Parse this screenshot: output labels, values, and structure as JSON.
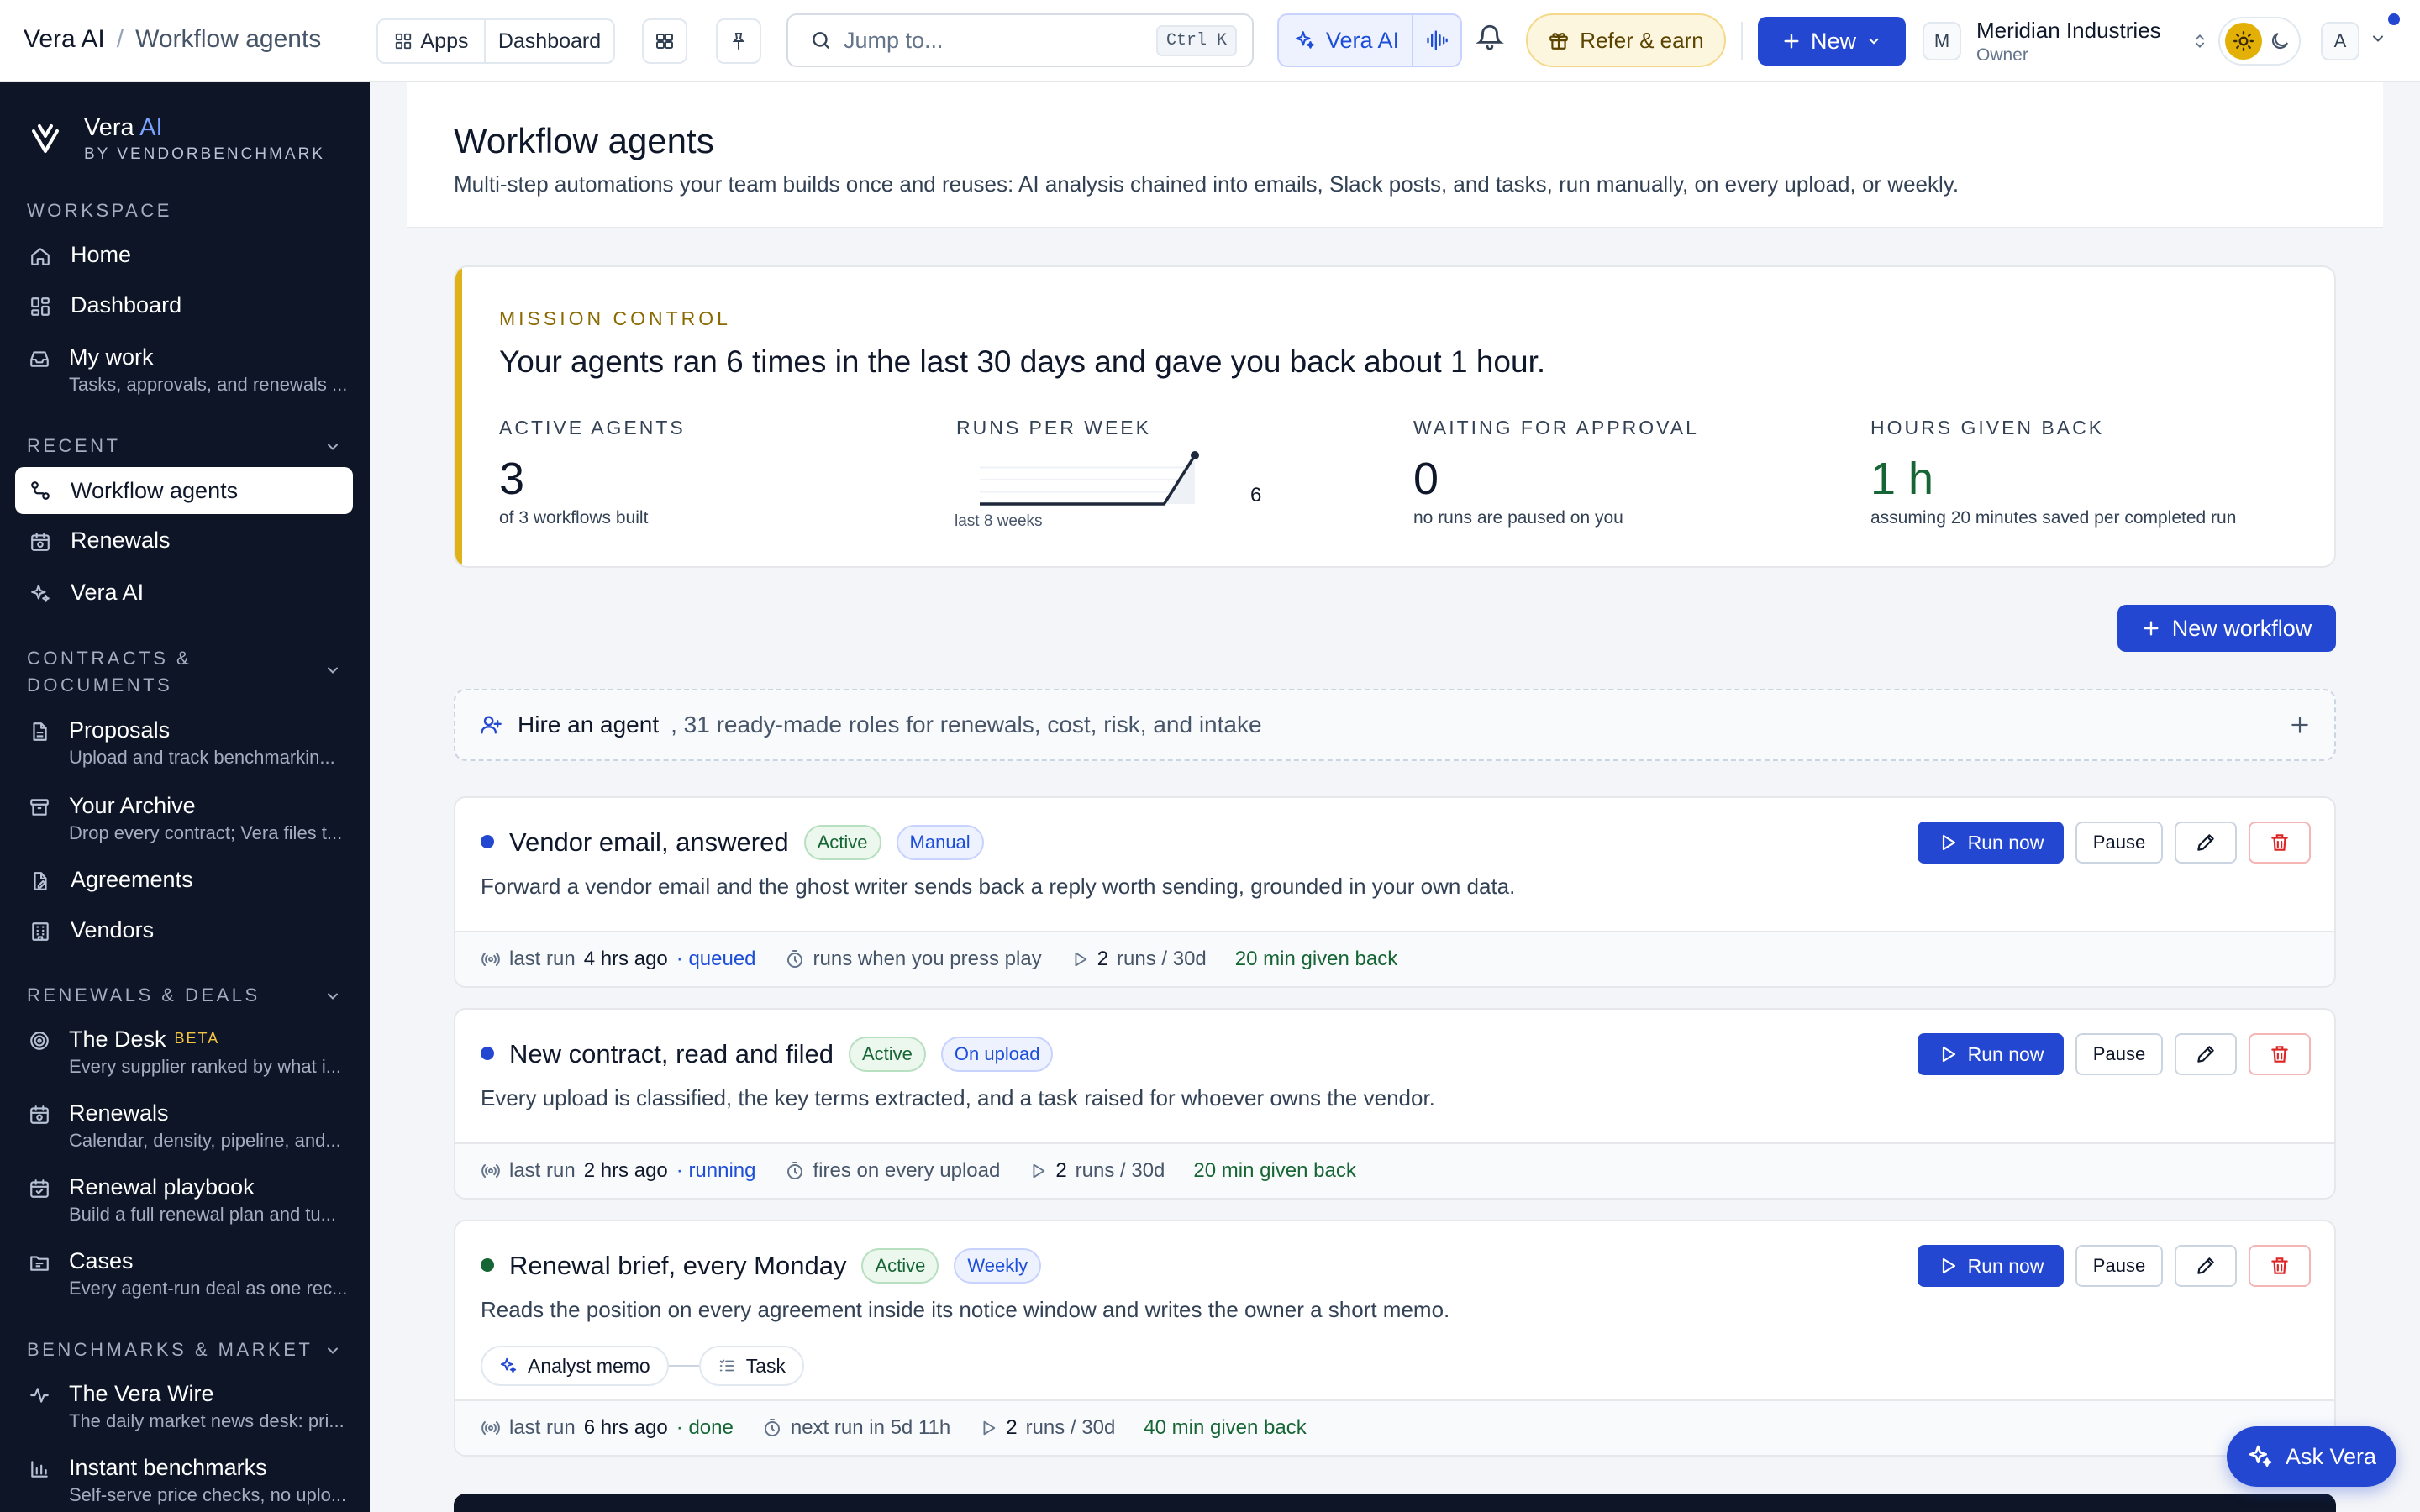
{
  "topbar": {
    "breadcrumb_root": "Vera AI",
    "breadcrumb_sep": "/",
    "breadcrumb_current": "Workflow agents",
    "apps_label": "Apps",
    "dashboard_label": "Dashboard",
    "search_placeholder": "Jump to...",
    "search_shortcut": "Ctrl K",
    "vera_label": "Vera AI",
    "refer_label": "Refer & earn",
    "new_label": "New",
    "org_initial": "M",
    "org_name": "Meridian Industries",
    "org_role": "Owner",
    "user_initial": "A"
  },
  "sidebar": {
    "brand_name": "Vera",
    "brand_ai": "AI",
    "brand_by": "BY VENDORBENCHMARK",
    "workspace_label": "WORKSPACE",
    "home": "Home",
    "dashboard": "Dashboard",
    "mywork": "My work",
    "mywork_sub": "Tasks, approvals, and renewals ...",
    "recent_label": "RECENT",
    "recent_workflow": "Workflow agents",
    "recent_renewals": "Renewals",
    "recent_vera": "Vera AI",
    "contracts_label_1": "CONTRACTS &",
    "contracts_label_2": "DOCUMENTS",
    "proposals": "Proposals",
    "proposals_sub": "Upload and track benchmarkin...",
    "archive": "Your Archive",
    "archive_sub": "Drop every contract; Vera files t...",
    "agreements": "Agreements",
    "vendors": "Vendors",
    "renewals_label": "RENEWALS & DEALS",
    "desk": "The Desk",
    "desk_badge": "BETA",
    "desk_sub": "Every supplier ranked by what i...",
    "renewals": "Renewals",
    "renewals_sub": "Calendar, density, pipeline, and...",
    "playbook": "Renewal playbook",
    "playbook_sub": "Build a full renewal plan and tu...",
    "cases": "Cases",
    "cases_sub": "Every agent-run deal as one rec...",
    "bench_label": "BENCHMARKS & MARKET",
    "wire": "The Vera Wire",
    "wire_sub": "The daily market news desk: pri...",
    "instant": "Instant benchmarks",
    "instant_sub": "Self-serve price checks, no uplo..."
  },
  "page": {
    "title": "Workflow agents",
    "subtitle": "Multi-step automations your team builds once and reuses: AI analysis chained into emails, Slack posts, and tasks, run manually, on every upload, or weekly."
  },
  "mission": {
    "kicker": "MISSION CONTROL",
    "headline": "Your agents ran 6 times in the last 30 days and gave you back about 1 hour.",
    "active_label": "ACTIVE AGENTS",
    "active_value": "3",
    "active_note": "of 3 workflows built",
    "runs_label": "RUNS PER WEEK",
    "runs_value": "6",
    "runs_caption": "last 8 weeks",
    "waiting_label": "WAITING FOR APPROVAL",
    "waiting_value": "0",
    "waiting_note": "no runs are paused on you",
    "hours_label": "HOURS GIVEN BACK",
    "hours_value": "1 h",
    "hours_note": "assuming 20 minutes saved per completed run"
  },
  "runs_sparkline": [
    0,
    0,
    0,
    0,
    0,
    0,
    0,
    6
  ],
  "actions": {
    "new_workflow": "New workflow",
    "hire_bold": "Hire an agent",
    "hire_rest": ", 31 ready-made roles for renewals, cost, risk, and intake",
    "run_now": "Run now",
    "pause": "Pause",
    "ask_vera": "Ask Vera"
  },
  "workflows": [
    {
      "name": "Vendor email, answered",
      "status": "Active",
      "trigger": "Manual",
      "description": "Forward a vendor email and the ghost writer sends back a reply worth sending, grounded in your own data.",
      "last_run_label": "last run",
      "last_run_time": "4 hrs ago",
      "last_run_state": "· queued",
      "schedule": "runs when you press play",
      "runs_count": "2",
      "runs_unit": "runs / 30d",
      "given_back": "20 min given back"
    },
    {
      "name": "New contract, read and filed",
      "status": "Active",
      "trigger": "On upload",
      "description": "Every upload is classified, the key terms extracted, and a task raised for whoever owns the vendor.",
      "last_run_label": "last run",
      "last_run_time": "2 hrs ago",
      "last_run_state": "· running",
      "schedule": "fires on every upload",
      "runs_count": "2",
      "runs_unit": "runs / 30d",
      "given_back": "20 min given back"
    },
    {
      "name": "Renewal brief, every Monday",
      "status": "Active",
      "trigger": "Weekly",
      "description": "Reads the position on every agreement inside its notice window and writes the owner a short memo.",
      "step_1": "Analyst memo",
      "step_2": "Task",
      "last_run_label": "last run",
      "last_run_time": "6 hrs ago",
      "last_run_state": "· done",
      "schedule": "next run in 5d 11h",
      "runs_count": "2",
      "runs_unit": "runs / 30d",
      "given_back": "40 min given back"
    }
  ],
  "colors": {
    "primary": "#2347d1",
    "sidebar_bg": "#0d1526",
    "accent_gold": "#e0b21a",
    "success": "#166534",
    "danger": "#dc2626"
  }
}
